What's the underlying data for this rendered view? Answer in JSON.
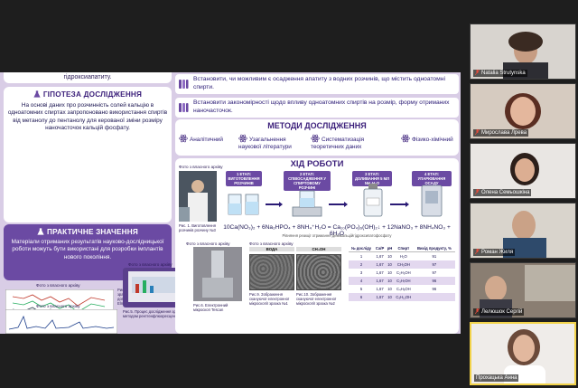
{
  "poster": {
    "top_fragment": "гідроксиапатиту.",
    "hypothesis": {
      "title": "ГІПОТЕЗА ДОСЛІДЖЕННЯ",
      "text": "На основі даних про розчинність солей кальцію в одноатомних спиртах запропоновано використання спиртів від метанолу до пентанолу для керованої зміни розміру наночасточок кальцій фосфату."
    },
    "practical": {
      "title": "ПРАКТИЧНЕ ЗНАЧЕННЯ",
      "text": "Матеріали отриманих результатів науково-дослідницької роботи можуть бути використані для розробки імплантів нового покоління."
    },
    "photo_caption": "Фото з власного архіву",
    "fig2_caption": "Рис.2 Інфрачервоні спектри зразків №1-6, одержані за допомогою приладу «Perkin Elmer Spectrum RX»",
    "fig5_caption": "Рис.5. Процес дослідження зразків методом рентгенфлюоресцентного",
    "aims": [
      "Встановити, чи можливим є осадження апатиту з водних розчинів, що містить одноатомні спирти.",
      "Встановити закономірності щодо впливу одноатомних спиртів на розмір, форму отриманих наночасточок."
    ],
    "methods": {
      "title": "МЕТОДИ ДОСЛІДЖЕННЯ",
      "items": [
        "Аналітичний",
        "Узагальнення наукової літератури",
        "Систематизація теоретичних даних",
        "Фізико-хімічний"
      ]
    },
    "work": {
      "title": "ХІД РОБОТИ",
      "photo_caption": "Фото з власного архіву",
      "stages": [
        "1 ЕТАП: ВИГОТОВЛЕННЯ РОЗЧИНІВ",
        "2 ЕТАП: СПІВОСАДЖЕННЯ У СПИРТОВОМУ РОЗЧИНІ",
        "3 ЕТАП: ДОЛИВАННЯ 5 МЛ NH₄H₂O",
        "4 ЕТАП: УПАРЮВАННЯ ОСАДУ"
      ],
      "fig1_caption": "Рис. 1. Виготовлення розчинів розчину №3",
      "equation": "10Ca(NO₃)₂ + 6Na₂HPO₄ + 8NH₄⁺H₂O = Ca₁₀(PO₄)₆(OH)₂↓ + 12NaNO₃ + 8NH₄NO₃ + 6H₂O",
      "equation_caption": "Рівняння реакції отримання декакальційгідроксипатофосфату",
      "fig6_caption": "Рис.6. Електронний мікроскоп Tescan",
      "sem_labels": [
        "ВОДА",
        "CH₃OH"
      ],
      "fig9_caption": "Рис.9. Зображення скануючої електронної мікроскопії зразка №1",
      "fig10_caption": "Рис.10. Зображення скануючої електронної мікроскопії зразка №2",
      "table": {
        "headers": [
          "№ досліду",
          "Ca/P",
          "pH",
          "Спирт",
          "Вихід продукту, %"
        ],
        "rows": [
          [
            "1",
            "1,67",
            "10",
            "H₂O",
            "91"
          ],
          [
            "2",
            "1,67",
            "10",
            "CH₃OH",
            "97"
          ],
          [
            "3",
            "1,67",
            "10",
            "C₂H₅OH",
            "97"
          ],
          [
            "4",
            "1,67",
            "10",
            "C₃H₇OH",
            "96"
          ],
          [
            "5",
            "1,67",
            "10",
            "C₄H₉OH",
            "96"
          ],
          [
            "6",
            "1,67",
            "10",
            "C₅H₁₁OH",
            ""
          ]
        ]
      }
    }
  },
  "participants": [
    {
      "name": "Natalia Strutynska"
    },
    {
      "name": "Мирослава Лрева"
    },
    {
      "name": "Олена Семьошкіна"
    },
    {
      "name": "Роман Жиля"
    },
    {
      "name": "Лелюшок Сергій"
    },
    {
      "name": "Прохацька Анна"
    }
  ],
  "colors": {
    "poster_bg": "#d9cde6",
    "accent": "#6b4aa3",
    "title": "#3b1f7a",
    "active_speaker": "#f2d34a"
  }
}
